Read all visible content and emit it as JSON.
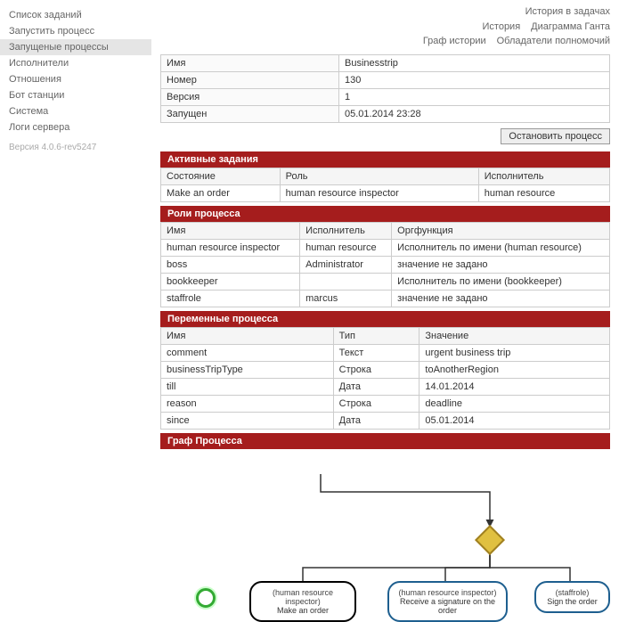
{
  "sidebar": {
    "items": [
      {
        "label": "Список заданий"
      },
      {
        "label": "Запустить процесс"
      },
      {
        "label": "Запущеные процессы",
        "active": true
      },
      {
        "label": "Исполнители"
      },
      {
        "label": "Отношения"
      },
      {
        "label": "Бот станции"
      },
      {
        "label": "Система"
      },
      {
        "label": "Логи сервера"
      }
    ],
    "version": "Версия 4.0.6-rev5247"
  },
  "topLinks": {
    "row1": [
      "История в задачах"
    ],
    "row2": [
      "История",
      "Диаграмма Ганта"
    ],
    "row3": [
      "Граф истории",
      "Обладатели полномочий"
    ]
  },
  "info": {
    "name_label": "Имя",
    "name_value": "Businesstrip",
    "num_label": "Номер",
    "num_value": "130",
    "ver_label": "Версия",
    "ver_value": "1",
    "start_label": "Запущен",
    "start_value": "05.01.2014 23:28"
  },
  "stopButton": "Остановить процесс",
  "sections": {
    "activeTasks": {
      "title": "Активные задания",
      "headers": [
        "Состояние",
        "Роль",
        "Исполнитель"
      ],
      "rows": [
        [
          "Make an order",
          "human resource inspector",
          "human resource"
        ]
      ]
    },
    "roles": {
      "title": "Роли процесса",
      "headers": [
        "Имя",
        "Исполнитель",
        "Оргфункция"
      ],
      "rows": [
        [
          "human resource inspector",
          "human resource",
          "Исполнитель по имени (human resource)"
        ],
        [
          "boss",
          "Administrator",
          "значение не задано"
        ],
        [
          "bookkeeper",
          "",
          "Исполнитель по имени (bookkeeper)"
        ],
        [
          "staffrole",
          "marcus",
          "значение не задано"
        ]
      ]
    },
    "variables": {
      "title": "Переменные процесса",
      "headers": [
        "Имя",
        "Тип",
        "Значение"
      ],
      "rows": [
        [
          "comment",
          "Текст",
          "urgent business trip"
        ],
        [
          "businessTripType",
          "Строка",
          "toAnotherRegion"
        ],
        [
          "till",
          "Дата",
          "14.01.2014"
        ],
        [
          "reason",
          "Строка",
          "deadline"
        ],
        [
          "since",
          "Дата",
          "05.01.2014"
        ]
      ]
    },
    "graph": {
      "title": "Граф Процесса"
    }
  },
  "graphNodes": {
    "n1": {
      "role": "(human resource inspector)",
      "task": "Make an order"
    },
    "n2": {
      "role": "(human resource inspector)",
      "task": "Receive a signature on the order"
    },
    "n3": {
      "role": "(staffrole)",
      "task": "Sign the order"
    }
  }
}
